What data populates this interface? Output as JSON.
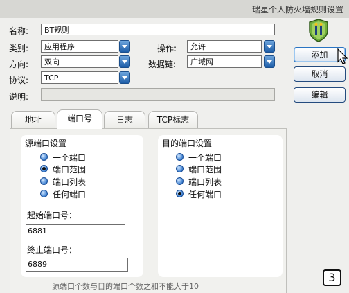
{
  "window": {
    "title": "瑞星个人防火墙规则设置"
  },
  "form": {
    "name_label": "名称:",
    "name_value": "BT规则",
    "category_label": "类别:",
    "category_value": "应用程序",
    "action_label": "操作:",
    "action_value": "允许",
    "direction_label": "方向:",
    "direction_value": "双向",
    "datalink_label": "数据链:",
    "datalink_value": "广域网",
    "protocol_label": "协议:",
    "protocol_value": "TCP",
    "desc_label": "说明:",
    "desc_value": ""
  },
  "buttons": {
    "add": "添加",
    "cancel": "取消",
    "edit": "编辑"
  },
  "tabs": [
    "地址",
    "端口号",
    "日志",
    "TCP标志"
  ],
  "active_tab": "端口号",
  "source_port": {
    "title": "源端口设置",
    "options": [
      "一个端口",
      "端口范围",
      "端口列表",
      "任何端口"
    ],
    "selected": "端口范围",
    "start_label": "起始端口号：",
    "start_value": "6881",
    "end_label": "终止端口号：",
    "end_value": "6889"
  },
  "dest_port": {
    "title": "目的端口设置",
    "options": [
      "一个端口",
      "端口范围",
      "端口列表",
      "任何端口"
    ],
    "selected": "任何端口"
  },
  "hint": "源端口个数与目的端口个数之和不能大于10",
  "step_badge": "3",
  "icons": {
    "app_icon": "shield-icon",
    "cursor": "mouse-cursor-icon",
    "dropdown": "chevron-down-icon"
  },
  "colors": {
    "accent": "#1e5ea8",
    "button_border": "#244b7e"
  }
}
